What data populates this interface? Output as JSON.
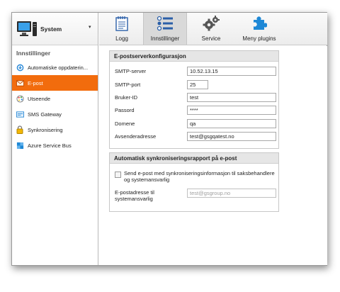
{
  "system": {
    "label": "System",
    "caret": "▾"
  },
  "sidebar": {
    "title": "Innstillinger",
    "items": [
      {
        "label": "Automatiske oppdaterin...",
        "icon": "update-icon"
      },
      {
        "label": "E-post",
        "icon": "email-icon"
      },
      {
        "label": "Utseende",
        "icon": "palette-icon"
      },
      {
        "label": "SMS Gateway",
        "icon": "sms-icon"
      },
      {
        "label": "Synkronisering",
        "icon": "lock-icon"
      },
      {
        "label": "Azure Service Bus",
        "icon": "azure-icon"
      }
    ],
    "active_index": 1
  },
  "ribbon": {
    "tabs": [
      {
        "label": "Logg",
        "icon": "notepad-icon"
      },
      {
        "label": "Innstillinger",
        "icon": "settings-list-icon"
      },
      {
        "label": "Service",
        "icon": "gears-icon"
      },
      {
        "label": "Meny plugins",
        "icon": "puzzle-icon"
      }
    ],
    "active_index": 1
  },
  "smtp": {
    "title": "E-postserverkonfigurasjon",
    "fields": [
      {
        "label": "SMTP-server",
        "value": "10.52.13.15"
      },
      {
        "label": "SMTP-port",
        "value": "25"
      },
      {
        "label": "Bruker-ID",
        "value": "test"
      },
      {
        "label": "Passord",
        "value": "****"
      },
      {
        "label": "Domene",
        "value": "qa"
      },
      {
        "label": "Avsenderadresse",
        "value": "test@gsgqatest.no"
      }
    ]
  },
  "sync_report": {
    "title": "Automatisk synkroniseringsrapport på e-post",
    "checkbox_label": "Send e-post med synkroniseringsinformasjon til saksbehandlere og systemansvarlig",
    "checked": false,
    "email_label": "E-postadresse til systemansvarlig",
    "email_placeholder": "test@gsgroup.no"
  },
  "colors": {
    "accent": "#f26c0d",
    "blue": "#1e88d6"
  }
}
